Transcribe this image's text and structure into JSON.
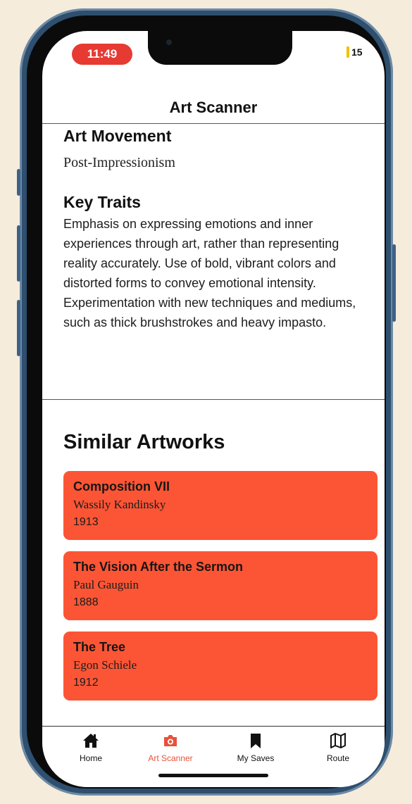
{
  "status_bar": {
    "time": "11:49",
    "battery": "15"
  },
  "header": {
    "title": "Art Scanner"
  },
  "art_movement": {
    "heading": "Art Movement",
    "value": "Post-Impressionism"
  },
  "key_traits": {
    "heading": "Key Traits",
    "text": "Emphasis on expressing emotions and inner experiences through art, rather than representing reality accurately. Use of bold, vibrant colors and distorted forms to convey emotional intensity. Experimentation with new techniques and mediums, such as thick brushstrokes and heavy impasto."
  },
  "similar": {
    "heading": "Similar Artworks",
    "items": [
      {
        "title": "Composition VII",
        "artist": "Wassily Kandinsky",
        "year": "1913"
      },
      {
        "title": "The Vision After the Sermon",
        "artist": "Paul Gauguin",
        "year": "1888"
      },
      {
        "title": "The Tree",
        "artist": "Egon Schiele",
        "year": "1912"
      }
    ]
  },
  "tabs": [
    {
      "label": "Home",
      "icon": "home-icon"
    },
    {
      "label": "Art Scanner",
      "icon": "camera-icon",
      "active": true
    },
    {
      "label": "My Saves",
      "icon": "bookmark-icon"
    },
    {
      "label": "Route",
      "icon": "map-icon"
    }
  ],
  "colors": {
    "accent": "#fc5535",
    "active_tab": "#e8513a",
    "time_pill": "#e63a33",
    "frame": "#2e4f6e"
  }
}
